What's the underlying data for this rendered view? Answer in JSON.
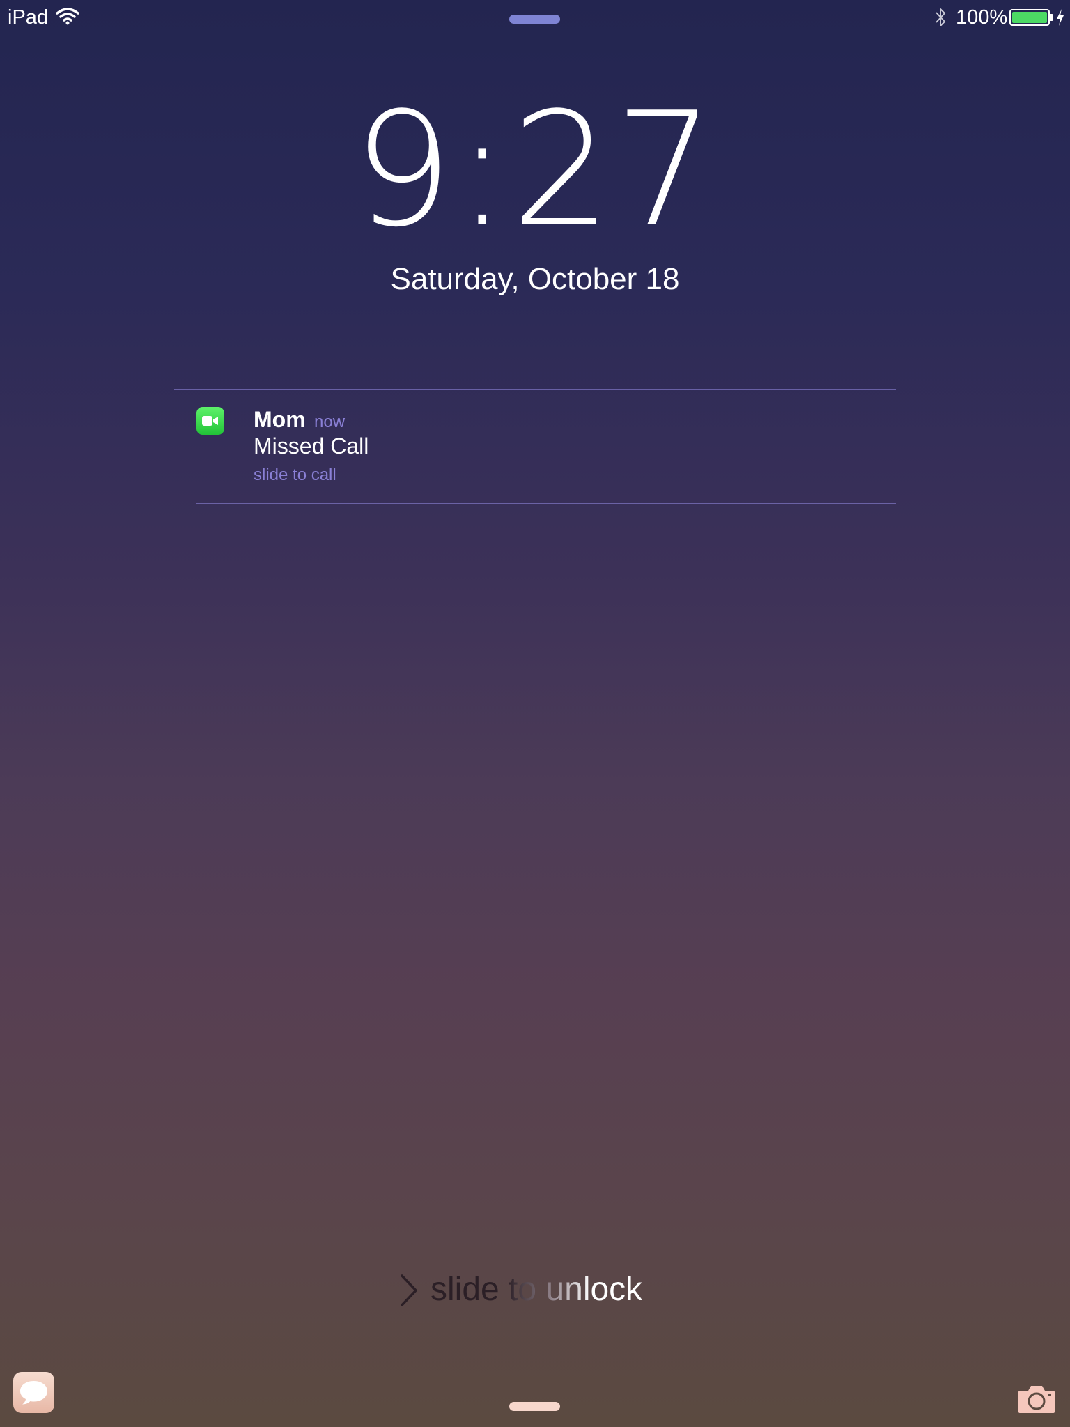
{
  "status_bar": {
    "carrier": "iPad",
    "battery_percent": "100%",
    "battery_level": 1.0,
    "icons": [
      "wifi-icon",
      "bluetooth-icon",
      "battery-icon",
      "charging-icon"
    ]
  },
  "lock_screen": {
    "time": "9:27",
    "date": "Saturday, October 18"
  },
  "notification": {
    "app_icon": "facetime-icon",
    "sender": "Mom",
    "time": "now",
    "message": "Missed Call",
    "action": "slide to call"
  },
  "unlock": {
    "label": "slide to unlock",
    "icon": "chevron-right-icon"
  },
  "bottom": {
    "left_shortcut_icon": "messages-icon",
    "right_shortcut_icon": "camera-icon"
  },
  "colors": {
    "accent": "#8a80d6",
    "battery": "#4cd964",
    "facetime": "#2fd14a",
    "grabber_top": "#7f84d4",
    "grabber_bottom": "#f7d7cc"
  }
}
